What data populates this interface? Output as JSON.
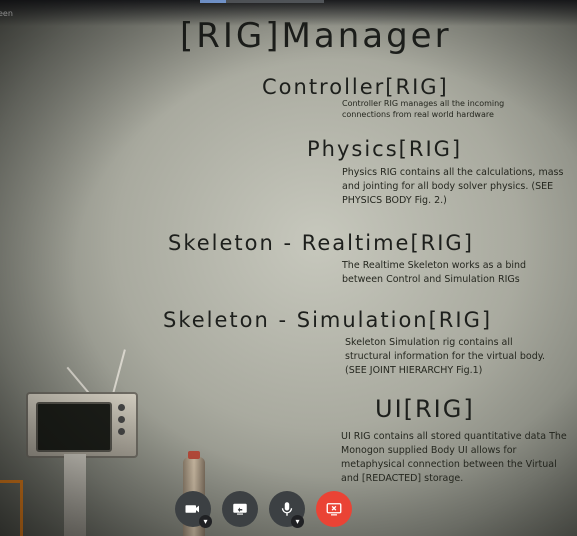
{
  "topbar": {
    "tag": "een"
  },
  "slide": {
    "title": "[RIG]Manager",
    "sections": [
      {
        "heading": "Controller[RIG]",
        "desc": "Controller RIG manages all the incoming connections from real world hardware"
      },
      {
        "heading": "Physics[RIG]",
        "desc": "Physics RIG contains all the calculations, mass and jointing for all body solver physics. (SEE PHYSICS BODY Fig. 2.)"
      },
      {
        "heading": "Skeleton - Realtime[RIG]",
        "desc": "The Realtime Skeleton works as a bind between Control and Simulation RIGs"
      },
      {
        "heading": "Skeleton - Simulation[RIG]",
        "desc": "Skeleton Simulation rig contains all structural information for the virtual body. (SEE JOINT HIERARCHY Fig.1)"
      },
      {
        "heading": "UI[RIG]",
        "desc": "UI RIG contains all stored quantitative data The Monogon supplied Body UI allows for metaphysical connection between the Virtual and [REDACTED] storage."
      }
    ]
  },
  "controls": {
    "camera": "camera-icon",
    "present": "present-screen-icon",
    "mic": "microphone-icon",
    "leave": "end-call-icon",
    "colors": {
      "button": "#3c4043",
      "leave": "#ea4335"
    }
  }
}
